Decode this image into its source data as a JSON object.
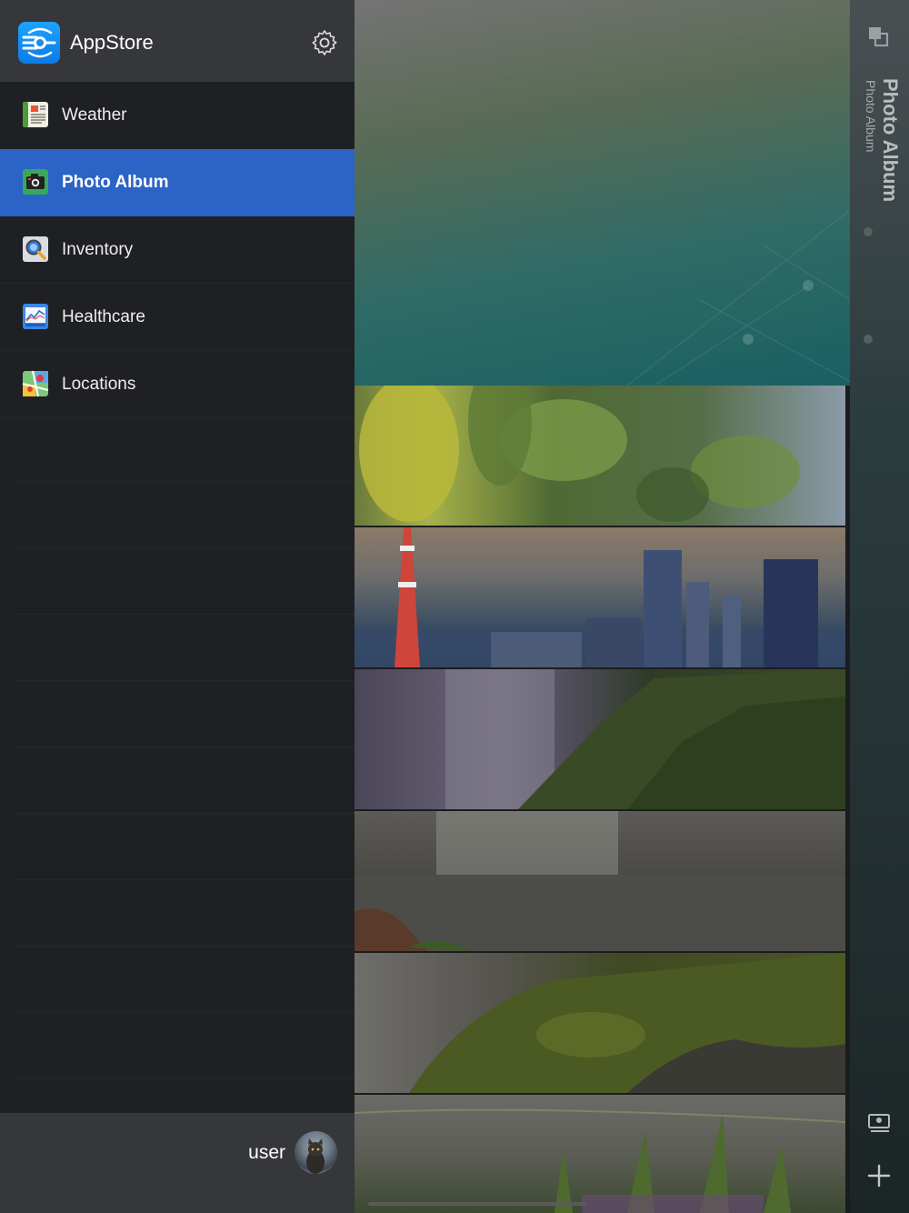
{
  "app": {
    "title": "AppStore"
  },
  "sidebar": {
    "items": [
      {
        "label": "Weather",
        "icon": "newspaper-icon",
        "active": false
      },
      {
        "label": "Photo Album",
        "icon": "camera-icon",
        "active": true
      },
      {
        "label": "Inventory",
        "icon": "magnifier-icon",
        "active": false
      },
      {
        "label": "Healthcare",
        "icon": "chart-icon",
        "active": false
      },
      {
        "label": "Locations",
        "icon": "map-icon",
        "active": false
      }
    ],
    "footer": {
      "user": "user"
    }
  },
  "rail": {
    "title": "Photo Album",
    "subtitle": "Photo Album"
  },
  "colors": {
    "sidebar_bg": "#1f2023",
    "header_bg": "#36373a",
    "active": "#2b63c6",
    "text": "#ffffff"
  }
}
